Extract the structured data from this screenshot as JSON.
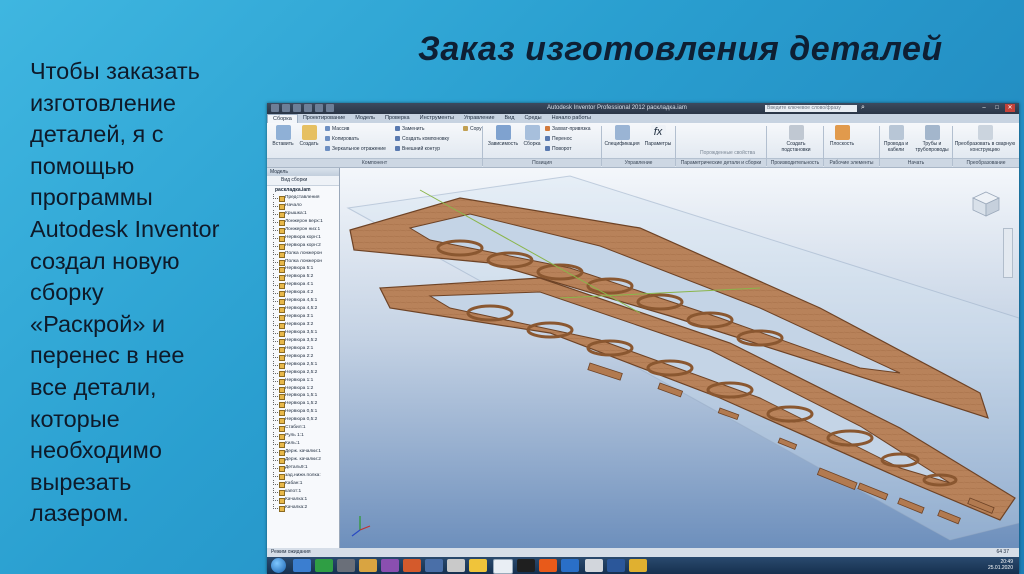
{
  "slide": {
    "title": "Заказ изготовления деталей",
    "body_lines": [
      "Чтобы заказать",
      "изготовление",
      "деталей, я с",
      "помощью",
      "программы",
      "Autodesk Inventor",
      "создал новую",
      "сборку",
      "«Раскрой» и",
      "перенес в нее",
      "все детали,",
      "которые",
      "необходимо",
      "вырезать",
      "лазером."
    ]
  },
  "app": {
    "window_title": "Autodesk Inventor Professional 2012   раскладка.iam",
    "search_placeholder": "Введите ключевое слово/фразу",
    "tabs": [
      "Сборка",
      "Проектирование",
      "Модель",
      "Проверка",
      "Инструменты",
      "Управление",
      "Вид",
      "Среды",
      "Начало работы"
    ],
    "ribbon": {
      "insert": "Вставить",
      "create": "Создать",
      "massive": "Массив",
      "copy": "Копировать",
      "mirror": "Зеркальное отражение",
      "replace": "Заменить",
      "create_layout": "Создать компоновку",
      "external_contour": "Внешний контур",
      "copy_small": "Copy",
      "dependency": "Зависимость",
      "assemble": "Сборка",
      "grab": "Захват-привязка",
      "move": "Перенос",
      "rotate": "Поворот",
      "spec": "Спецификация",
      "params": "Параметры",
      "derived_props": "Порожденные свойства",
      "create_substitute": "Создать подстановки",
      "plane": "Плоскость",
      "wires": "Провода и кабели",
      "pipes": "Трубы и трубопроводы",
      "weld": "Преобразовать в сварную конструкцию",
      "group_component": "Компонент",
      "group_position": "Позиция",
      "group_manage": "Управление",
      "group_param": "Параметрические детали и сборки",
      "group_perf": "Производительность",
      "group_work": "Рабочие элементы",
      "group_start": "Начать",
      "group_convert": "Преобразование"
    },
    "browser": {
      "header": "Модель",
      "view_label": "Вид сборки",
      "root": "раскладка.iam",
      "items": [
        "Представления",
        "Начало",
        "Крышка:1",
        "Лонжерон верх:1",
        "Лонжерон низ:1",
        "Нервюра корн:1",
        "Нервюра корн:2",
        "Полка лонжерон",
        "Полка лонжерон",
        "Нервюра 5:1",
        "Нервюра 5:2",
        "Нервюра 4:1",
        "Нервюра 4:2",
        "Нервюра 4,5:1",
        "Нервюра 4,5:2",
        "Нервюра 3:1",
        "Нервюра 3:2",
        "Нервюра 3,5:1",
        "Нервюра 3,5:2",
        "Нервюра 2:1",
        "Нервюра 2:2",
        "Нервюра 2,5:1",
        "Нервюра 2,5:2",
        "Нервюра 1:1",
        "Нервюра 1:2",
        "Нервюра 1,5:1",
        "Нервюра 1,5:2",
        "Нервюра 0,5:1",
        "Нервюра 0,5:2",
        "Стабил:1",
        "Руль 1:1",
        "Киль:1",
        "Держ. качалки:1",
        "Держ. качалки:2",
        "Деталь9:1",
        "зад.нижн.полка:",
        "Кабан:1",
        "капот:1",
        "Качалка:1",
        "Качалка:2"
      ]
    },
    "status": {
      "left": "Режим ожидания",
      "right": "64     37"
    },
    "clock": {
      "time": "20:49",
      "date": "25.01.2020"
    }
  },
  "colors": {
    "slide_bg": "#2a9fd0",
    "wood": "#b8825a",
    "wood_edge": "#6e4326"
  }
}
